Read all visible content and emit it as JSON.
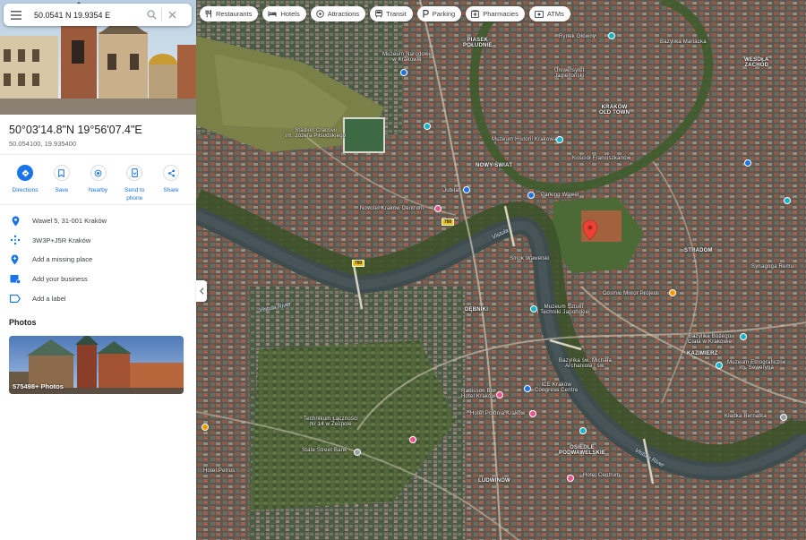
{
  "search": {
    "value": "50.0541 N 19.9354 E"
  },
  "place": {
    "title": "50°03'14.8\"N 19°56'07.4\"E",
    "decimal": "50.054100, 19.935400"
  },
  "actions": [
    {
      "label": "Directions",
      "icon": "directions-icon"
    },
    {
      "label": "Save",
      "icon": "bookmark-icon"
    },
    {
      "label": "Nearby",
      "icon": "nearby-icon"
    },
    {
      "label": "Send to phone",
      "icon": "send-to-phone-icon"
    },
    {
      "label": "Share",
      "icon": "share-icon"
    }
  ],
  "info": [
    {
      "text": "Wawel 5, 31-001 Kraków",
      "icon": "location-pin-icon"
    },
    {
      "text": "3W3P+J5R Kraków",
      "icon": "plus-code-icon"
    },
    {
      "text": "Add a missing place",
      "icon": "add-place-icon"
    },
    {
      "text": "Add your business",
      "icon": "business-icon"
    },
    {
      "text": "Add a label",
      "icon": "label-icon"
    }
  ],
  "photos": {
    "heading": "Photos",
    "count": "575498+ Photos"
  },
  "chips": [
    {
      "label": "Restaurants",
      "icon": "restaurant-icon"
    },
    {
      "label": "Hotels",
      "icon": "hotel-icon"
    },
    {
      "label": "Attractions",
      "icon": "attractions-icon"
    },
    {
      "label": "Transit",
      "icon": "transit-icon"
    },
    {
      "label": "Parking",
      "icon": "parking-icon"
    },
    {
      "label": "Pharmacies",
      "icon": "pharmacy-icon"
    },
    {
      "label": "ATMs",
      "icon": "atm-icon"
    }
  ],
  "map_labels": {
    "piasek_1": "PIASEK",
    "piasek_2": "POŁUDNIE",
    "krakow_1": "KRAKÓW",
    "krakow_2": "OLD TOWN",
    "nowy_swiat": "NOWY ŚWIAT",
    "debniki": "DĘBNIKI",
    "stradom": "STRADOM",
    "kazimierz": "KAZIMIERZ",
    "osiedle_1": "OSIEDLE",
    "osiedle_2": "PODWAWELSKIE",
    "ludwinow": "LUDWINÓW",
    "wesola_1": "WESOŁA",
    "wesola_2": "ZACHÓD"
  },
  "map_pois": {
    "muzeum_narodowe_1": "Muzeum Narodowe",
    "muzeum_narodowe_2": "w Krakowie",
    "stadion_1": "Stadion Cracovii",
    "stadion_2": "im. Józefa Piłsudskiego",
    "muzeum_nauk": "Muzeum Historii Krakowa",
    "kosciol": "Kościół Franciszkanów",
    "parking_wawel": "Parking Wawel",
    "novotel": "Novotel Kraków Centrum",
    "smok": "Smok Wawelski",
    "manggha_1": "Muzeum Sztuki",
    "manggha_2": "i Techniki Japońskiej",
    "cosmic": "Cosmic Mirror Project",
    "bozego_1": "Bazylika Bożego",
    "bozego_2": "Ciała w Krakowie",
    "mich_1": "Bazylika św. Michała",
    "mich_2": "Archanioła i św.",
    "etno_1": "Muzeum Etnograficzne",
    "etno_2": "im. Seweryna",
    "ice_1": "ICE Kraków",
    "ice_2": "Congress Centre",
    "hotel_pol": "Hotel Polonia Kraków",
    "kladka": "Kładka Bernatka",
    "technikum_1": "Technikum Łączności",
    "technikum_2": "Nr 14 w Zespole",
    "state_street": "State Street Bank",
    "radisson_1": "Radisson Blu",
    "radisson_2": "Hotel Kraków",
    "synagoga": "Synagoga Remu",
    "hotel_petrus": "Hotel Petrus",
    "bazylika_maria": "Bazylika Mariacka",
    "rynek": "Rynek Główny",
    "uni_1": "Uniwersytet",
    "uni_2": "Jagielloński",
    "jubilat": "Jubilat",
    "hotel_centrum": "Hotel Centrum"
  },
  "river": {
    "name_west": "Vistula River",
    "name_center": "Vistula",
    "name_east": "Vistula River"
  },
  "road_shields": [
    "780",
    "780"
  ],
  "colors": {
    "accent": "#1a73e8",
    "pin": "#ea4335"
  }
}
